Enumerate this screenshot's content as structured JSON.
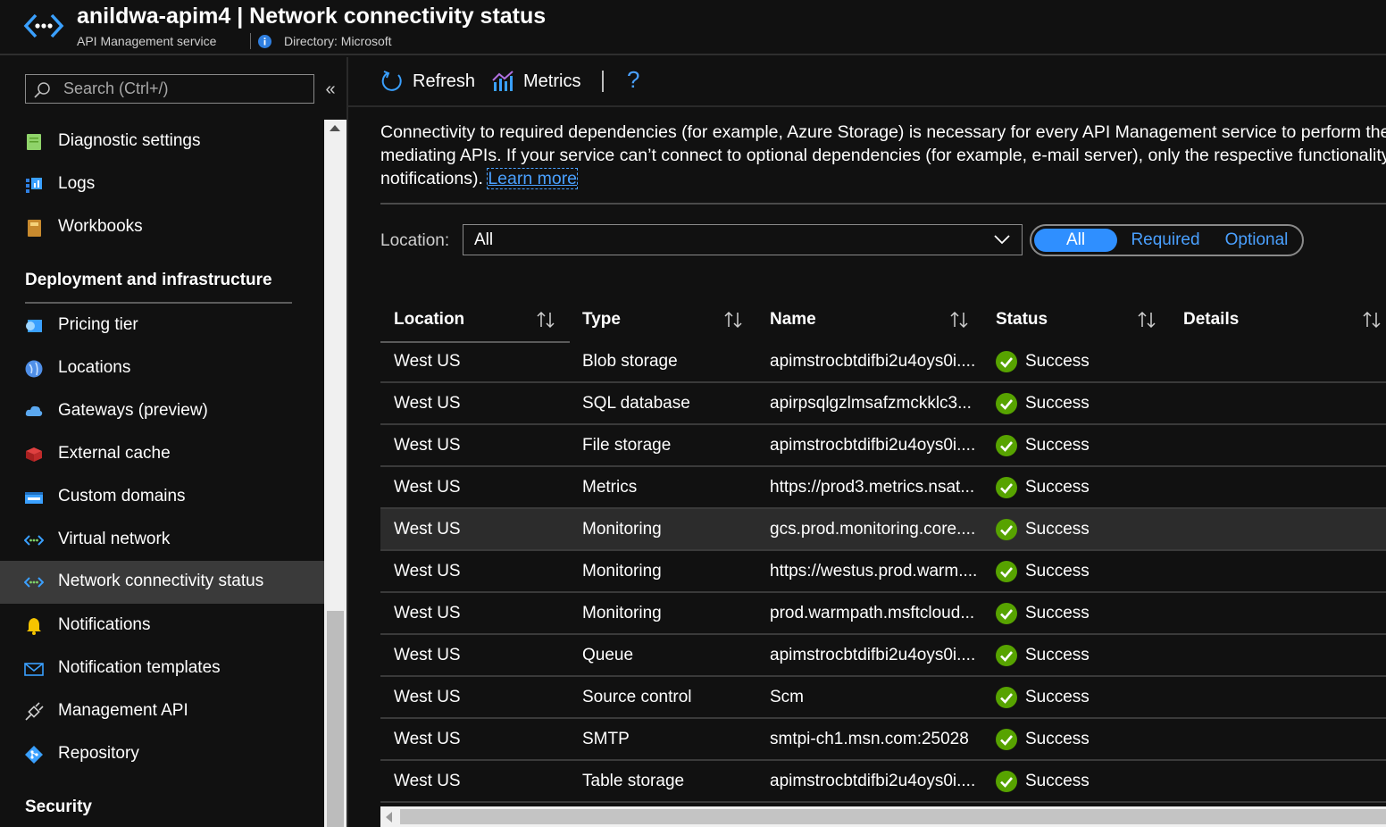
{
  "header": {
    "title": "anildwa-apim4 | Network connectivity status",
    "subtitle": "API Management service",
    "directory": "Directory: Microsoft"
  },
  "sidebar": {
    "search_placeholder": "Search (Ctrl+/)",
    "collapse_glyph": "«",
    "items": [
      {
        "label": "Diagnostic settings",
        "icon": "diagnostic-settings-icon"
      },
      {
        "label": "Logs",
        "icon": "logs-icon"
      },
      {
        "label": "Workbooks",
        "icon": "workbooks-icon"
      },
      {
        "label": "Pricing tier",
        "icon": "pricing-tier-icon"
      },
      {
        "label": "Locations",
        "icon": "locations-icon"
      },
      {
        "label": "Gateways (preview)",
        "icon": "gateways-icon"
      },
      {
        "label": "External cache",
        "icon": "external-cache-icon"
      },
      {
        "label": "Custom domains",
        "icon": "custom-domains-icon"
      },
      {
        "label": "Virtual network",
        "icon": "virtual-network-icon"
      },
      {
        "label": "Network connectivity status",
        "icon": "network-connectivity-icon",
        "active": true
      },
      {
        "label": "Notifications",
        "icon": "bell-icon"
      },
      {
        "label": "Notification templates",
        "icon": "envelope-icon"
      },
      {
        "label": "Management API",
        "icon": "plug-icon"
      },
      {
        "label": "Repository",
        "icon": "repository-icon"
      }
    ],
    "sections": {
      "deployment": "Deployment and infrastructure",
      "security": "Security"
    }
  },
  "toolbar": {
    "refresh_label": "Refresh",
    "metrics_label": "Metrics",
    "help_glyph": "?"
  },
  "description": {
    "line1": "Connectivity to required dependencies (for example, Azure Storage) is necessary for every API Management service to perform the",
    "line2": "mediating APIs. If your service can’t connect to optional dependencies (for example, e-mail server), only the respective functionality",
    "line3": "notifications).",
    "learn_more": "Learn more"
  },
  "filters": {
    "location_label": "Location:",
    "location_value": "All",
    "segments": [
      "All",
      "Required",
      "Optional"
    ],
    "selected_segment": "All"
  },
  "table": {
    "columns": [
      "Location",
      "Type",
      "Name",
      "Status",
      "Details"
    ],
    "rows": [
      {
        "location": "West US",
        "type": "Blob storage",
        "name": "apimstrocbtdifbi2u4oys0i....",
        "status": "Success"
      },
      {
        "location": "West US",
        "type": "SQL database",
        "name": "apirpsqlgzlmsafzmckklc3...",
        "status": "Success"
      },
      {
        "location": "West US",
        "type": "File storage",
        "name": "apimstrocbtdifbi2u4oys0i....",
        "status": "Success"
      },
      {
        "location": "West US",
        "type": "Metrics",
        "name": "https://prod3.metrics.nsat...",
        "status": "Success"
      },
      {
        "location": "West US",
        "type": "Monitoring",
        "name": "gcs.prod.monitoring.core....",
        "status": "Success",
        "highlighted": true
      },
      {
        "location": "West US",
        "type": "Monitoring",
        "name": "https://westus.prod.warm....",
        "status": "Success"
      },
      {
        "location": "West US",
        "type": "Monitoring",
        "name": "prod.warmpath.msftcloud...",
        "status": "Success"
      },
      {
        "location": "West US",
        "type": "Queue",
        "name": "apimstrocbtdifbi2u4oys0i....",
        "status": "Success"
      },
      {
        "location": "West US",
        "type": "Source control",
        "name": "Scm",
        "status": "Success"
      },
      {
        "location": "West US",
        "type": "SMTP",
        "name": "smtpi-ch1.msn.com:25028",
        "status": "Success"
      },
      {
        "location": "West US",
        "type": "Table storage",
        "name": "apimstrocbtdifbi2u4oys0i....",
        "status": "Success"
      }
    ]
  },
  "colors": {
    "accent": "#2f8fff",
    "link": "#4aa0ff",
    "success": "#57a300",
    "background": "#111111"
  }
}
